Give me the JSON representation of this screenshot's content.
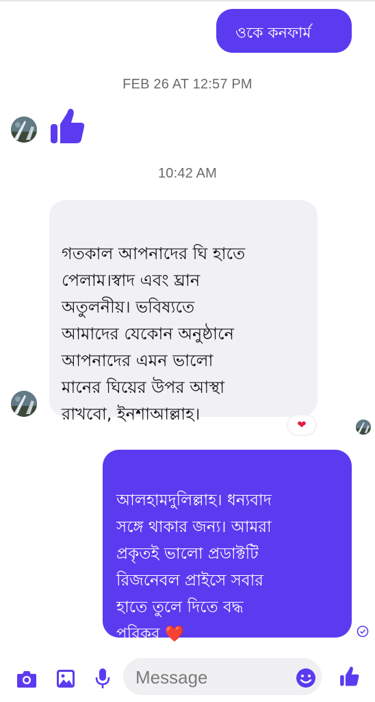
{
  "colors": {
    "accent": "#5b3bf0",
    "incoming_bubble": "#f0f0f5",
    "reaction_heart": "#e02040"
  },
  "messages": [
    {
      "direction": "outgoing",
      "text": "ওকে কনফার্ম"
    },
    {
      "type": "timestamp",
      "text": "FEB 26 AT 12:57 PM"
    },
    {
      "direction": "incoming",
      "type": "like",
      "icon": "thumbs-up-icon"
    },
    {
      "type": "timestamp",
      "text": "10:42 AM"
    },
    {
      "direction": "incoming",
      "text": "গতকাল আপনাদের ঘি হাতে\nপেলাম।স্বাদ এবং ঘ্রান\nঅতুলনীয়।  ভবিষ্যতে\nআমাদের যেকোন অনুষ্ঠানে\nআপনাদের  এমন ভালো\nমানের ঘিয়ের উপর আস্থা\nরাখবো, ইনশাআল্লাহ।",
      "reaction": "❤"
    },
    {
      "direction": "outgoing",
      "text": "আলহামদুলিল্লাহ। ধন্যবাদ\nসঙ্গে থাকার জন্য। আমরা\nপ্রকৃতই ভালো প্রডাক্টটি\nরিজনেবল প্রাইসে সবার\nহাতে তুলে দিতে বদ্ধ\nপরিকর ❤️"
    }
  ],
  "composer": {
    "placeholder": "Message",
    "icons": [
      "camera-icon",
      "gallery-icon",
      "microphone-icon",
      "emoji-icon",
      "thumbs-up-icon"
    ]
  }
}
